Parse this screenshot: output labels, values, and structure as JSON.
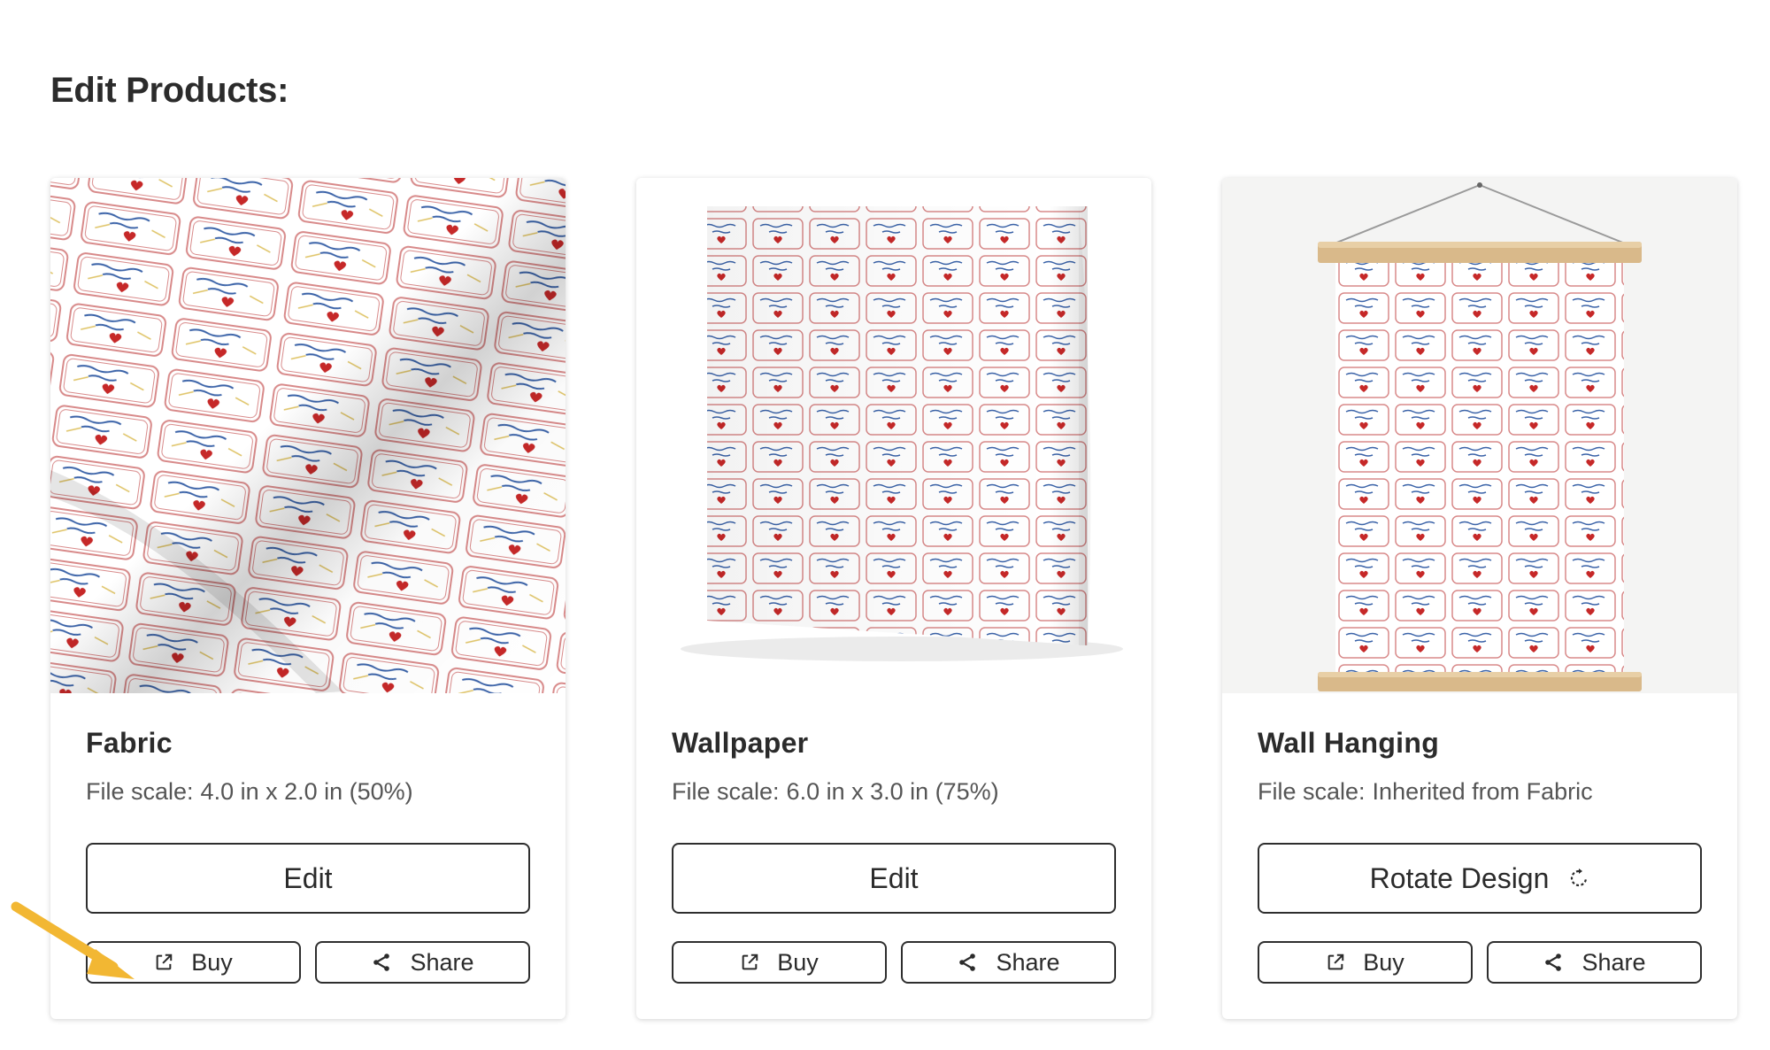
{
  "page": {
    "title": "Edit Products:"
  },
  "products": [
    {
      "name": "Fabric",
      "scale_label": "File scale:",
      "scale_value": "4.0 in x 2.0 in (50%)",
      "primary_button": "Edit",
      "buy_label": "Buy",
      "share_label": "Share"
    },
    {
      "name": "Wallpaper",
      "scale_label": "File scale:",
      "scale_value": "6.0 in x 3.0 in (75%)",
      "primary_button": "Edit",
      "buy_label": "Buy",
      "share_label": "Share"
    },
    {
      "name": "Wall Hanging",
      "scale_label": "File scale:",
      "scale_value": "Inherited from Fabric",
      "primary_button": "Rotate Design",
      "buy_label": "Buy",
      "share_label": "Share"
    }
  ],
  "icons": {
    "buy": "external-link-icon",
    "share": "share-icon",
    "rotate": "rotate-icon",
    "annotation": "pointer-arrow"
  },
  "colors": {
    "label_border": "#d88a8a",
    "label_text": "#3b63a8",
    "heart": "#c62828",
    "wood": "#d9b98a",
    "annotation_arrow": "#f2b733"
  }
}
